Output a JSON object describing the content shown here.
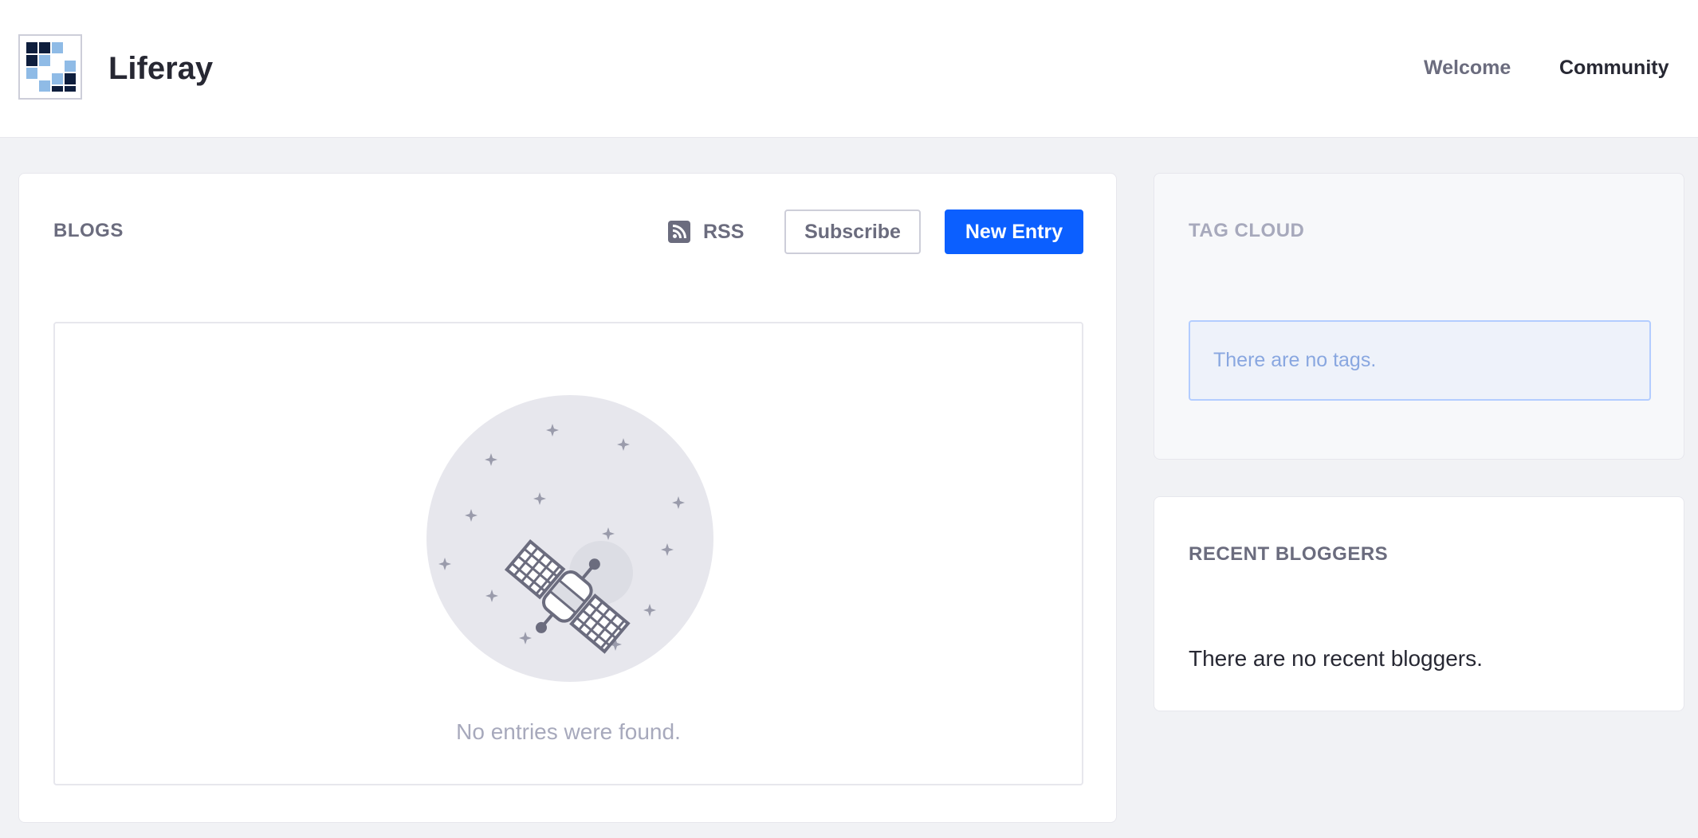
{
  "header": {
    "site_name": "Liferay",
    "logo_icon": "liferay-logo-icon",
    "nav": [
      {
        "label": "Welcome",
        "active": false
      },
      {
        "label": "Community",
        "active": true
      }
    ]
  },
  "blogs": {
    "title": "BLOGS",
    "rss_label": "RSS",
    "rss_icon": "rss-icon",
    "subscribe_label": "Subscribe",
    "new_entry_label": "New Entry",
    "empty_icon": "satellite-empty-state-icon",
    "empty_message": "No entries were found."
  },
  "tag_cloud": {
    "title": "TAG CLOUD",
    "empty_message": "There are no tags."
  },
  "recent_bloggers": {
    "title": "RECENT BLOGGERS",
    "empty_message": "There are no recent bloggers."
  },
  "colors": {
    "primary": "#0b5fff",
    "background": "#f1f2f5",
    "text": "#272833",
    "secondary_text": "#6b6c7e",
    "muted_text": "#a7a9bc"
  }
}
